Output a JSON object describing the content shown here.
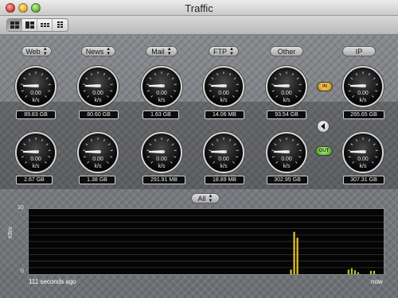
{
  "window": {
    "title": "Traffic"
  },
  "toolbar": {
    "view_buttons": [
      "grid-large-icon",
      "grid-split-icon",
      "grid-small-icon",
      "grid-dense-icon"
    ],
    "active_index": 0
  },
  "columns": [
    {
      "label": "Web",
      "in": {
        "rate": "0.00",
        "unit": "k/s",
        "total": "89.83 GB"
      },
      "out": {
        "rate": "0.00",
        "unit": "k/s",
        "total": "2.67 GB"
      }
    },
    {
      "label": "News",
      "in": {
        "rate": "0.00",
        "unit": "k/s",
        "total": "80.60 GB"
      },
      "out": {
        "rate": "0.00",
        "unit": "k/s",
        "total": "1.38 GB"
      }
    },
    {
      "label": "Mail",
      "in": {
        "rate": "0.00",
        "unit": "k/s",
        "total": "1.63 GB"
      },
      "out": {
        "rate": "0.00",
        "unit": "k/s",
        "total": "291.91 MB"
      }
    },
    {
      "label": "FTP",
      "in": {
        "rate": "0.00",
        "unit": "k/s",
        "total": "14.06 MB"
      },
      "out": {
        "rate": "0.00",
        "unit": "k/s",
        "total": "18.89 MB"
      }
    },
    {
      "label": "Other",
      "in": {
        "rate": "0.00",
        "unit": "k/s",
        "total": "93.54 GB"
      },
      "out": {
        "rate": "0.00",
        "unit": "k/s",
        "total": "302.95 GB"
      }
    },
    {
      "label": "IP",
      "in": {
        "rate": "0.00",
        "unit": "k/s",
        "total": "265.65 GB"
      },
      "out": {
        "rate": "0.00",
        "unit": "k/s",
        "total": "307.31 GB"
      }
    }
  ],
  "direction": {
    "in_label": "IN",
    "out_label": "OUT"
  },
  "graph": {
    "filter_label": "All",
    "ylabel": "KB/s",
    "y_max": "10",
    "y_min": "0",
    "start_label": "111 seconds ago",
    "end_label": "now",
    "colors": {
      "in": "#e8c330",
      "out": "#9bd636",
      "grid": "#3a3a3a"
    }
  },
  "chart_data": {
    "type": "bar",
    "ylabel": "KB/s",
    "ylim": [
      0,
      10
    ],
    "x_range_seconds_ago": [
      111,
      0
    ],
    "series": [
      {
        "x_seconds_ago": [
          29,
          28,
          27
        ],
        "values": [
          0.7,
          6.5,
          5.6
        ]
      },
      {
        "x_seconds_ago": [
          11,
          10,
          9,
          8,
          4,
          3
        ],
        "values": [
          0.7,
          0.9,
          0.6,
          0.3,
          0.5,
          0.5
        ]
      }
    ],
    "grid": true
  }
}
